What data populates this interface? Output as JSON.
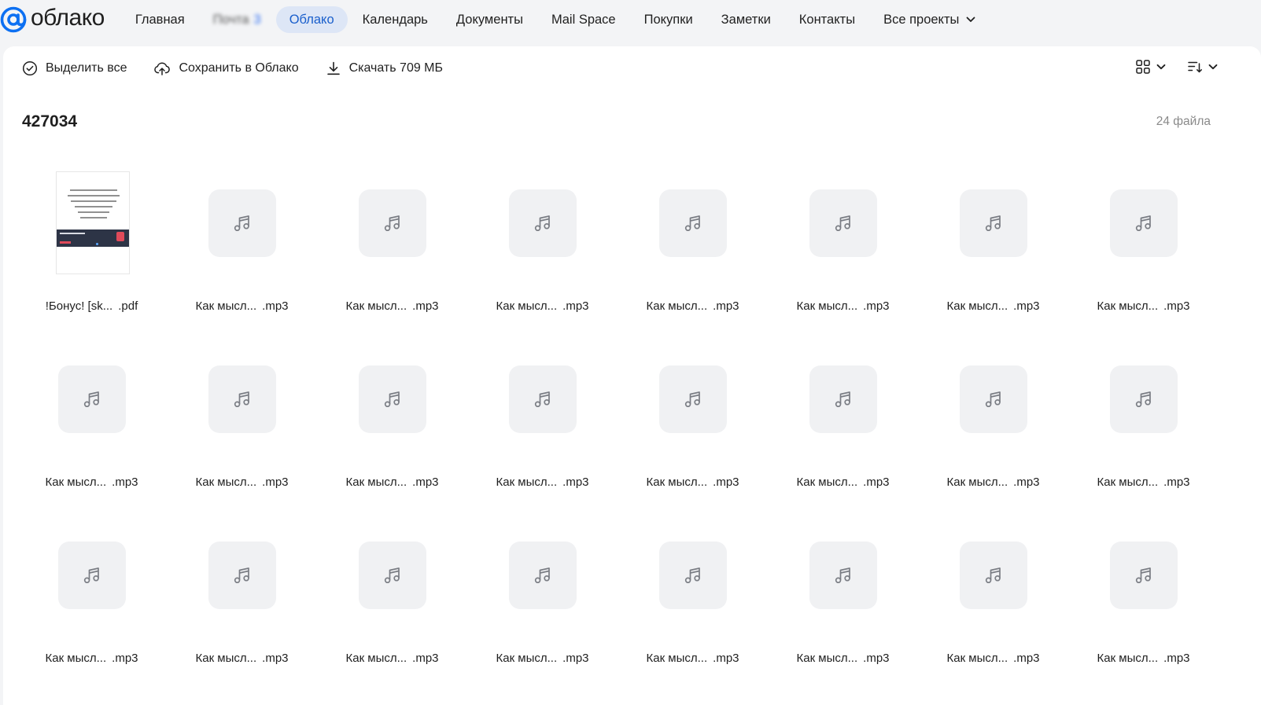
{
  "brand": {
    "logo_text": "облако",
    "accent_color": "#0d70f2",
    "active_tab_bg": "#dde6f6",
    "active_tab_text": "#1a5fcc"
  },
  "nav": {
    "items": [
      {
        "label": "Главная",
        "active": false
      },
      {
        "label": "Почта",
        "badge": "3",
        "active": false,
        "blurred": true
      },
      {
        "label": "Облако",
        "active": true
      },
      {
        "label": "Календарь",
        "active": false
      },
      {
        "label": "Документы",
        "active": false
      },
      {
        "label": "Mail Space",
        "active": false
      },
      {
        "label": "Покупки",
        "active": false
      },
      {
        "label": "Заметки",
        "active": false
      },
      {
        "label": "Контакты",
        "active": false
      }
    ],
    "more_label": "Все проекты",
    "more_icon": "chevron-down-icon"
  },
  "toolbar": {
    "select_all_label": "Выделить все",
    "select_all_icon": "check-circle-icon",
    "save_label": "Сохранить в Облако",
    "save_icon": "cloud-upload-icon",
    "download_label": "Скачать 709 МБ",
    "download_icon": "download-icon",
    "view_mode_icon": "grid-view-icon",
    "sort_icon": "sort-icon"
  },
  "folder": {
    "title": "427034",
    "count_label": "24 файла"
  },
  "files": [
    {
      "type": "pdf",
      "name_base": "!Бонус! [sk...",
      "ext": ".pdf"
    },
    {
      "type": "audio",
      "name_base": "Как мысл...",
      "ext": ".mp3"
    },
    {
      "type": "audio",
      "name_base": "Как мысл...",
      "ext": ".mp3"
    },
    {
      "type": "audio",
      "name_base": "Как мысл...",
      "ext": ".mp3"
    },
    {
      "type": "audio",
      "name_base": "Как мысл...",
      "ext": ".mp3"
    },
    {
      "type": "audio",
      "name_base": "Как мысл...",
      "ext": ".mp3"
    },
    {
      "type": "audio",
      "name_base": "Как мысл...",
      "ext": ".mp3"
    },
    {
      "type": "audio",
      "name_base": "Как мысл...",
      "ext": ".mp3"
    },
    {
      "type": "audio",
      "name_base": "Как мысл...",
      "ext": ".mp3"
    },
    {
      "type": "audio",
      "name_base": "Как мысл...",
      "ext": ".mp3"
    },
    {
      "type": "audio",
      "name_base": "Как мысл...",
      "ext": ".mp3"
    },
    {
      "type": "audio",
      "name_base": "Как мысл...",
      "ext": ".mp3"
    },
    {
      "type": "audio",
      "name_base": "Как мысл...",
      "ext": ".mp3"
    },
    {
      "type": "audio",
      "name_base": "Как мысл...",
      "ext": ".mp3"
    },
    {
      "type": "audio",
      "name_base": "Как мысл...",
      "ext": ".mp3"
    },
    {
      "type": "audio",
      "name_base": "Как мысл...",
      "ext": ".mp3"
    },
    {
      "type": "audio",
      "name_base": "Как мысл...",
      "ext": ".mp3"
    },
    {
      "type": "audio",
      "name_base": "Как мысл...",
      "ext": ".mp3"
    },
    {
      "type": "audio",
      "name_base": "Как мысл...",
      "ext": ".mp3"
    },
    {
      "type": "audio",
      "name_base": "Как мысл...",
      "ext": ".mp3"
    },
    {
      "type": "audio",
      "name_base": "Как мысл...",
      "ext": ".mp3"
    },
    {
      "type": "audio",
      "name_base": "Как мысл...",
      "ext": ".mp3"
    },
    {
      "type": "audio",
      "name_base": "Как мысл...",
      "ext": ".mp3"
    },
    {
      "type": "audio",
      "name_base": "Как мысл...",
      "ext": ".mp3"
    }
  ]
}
